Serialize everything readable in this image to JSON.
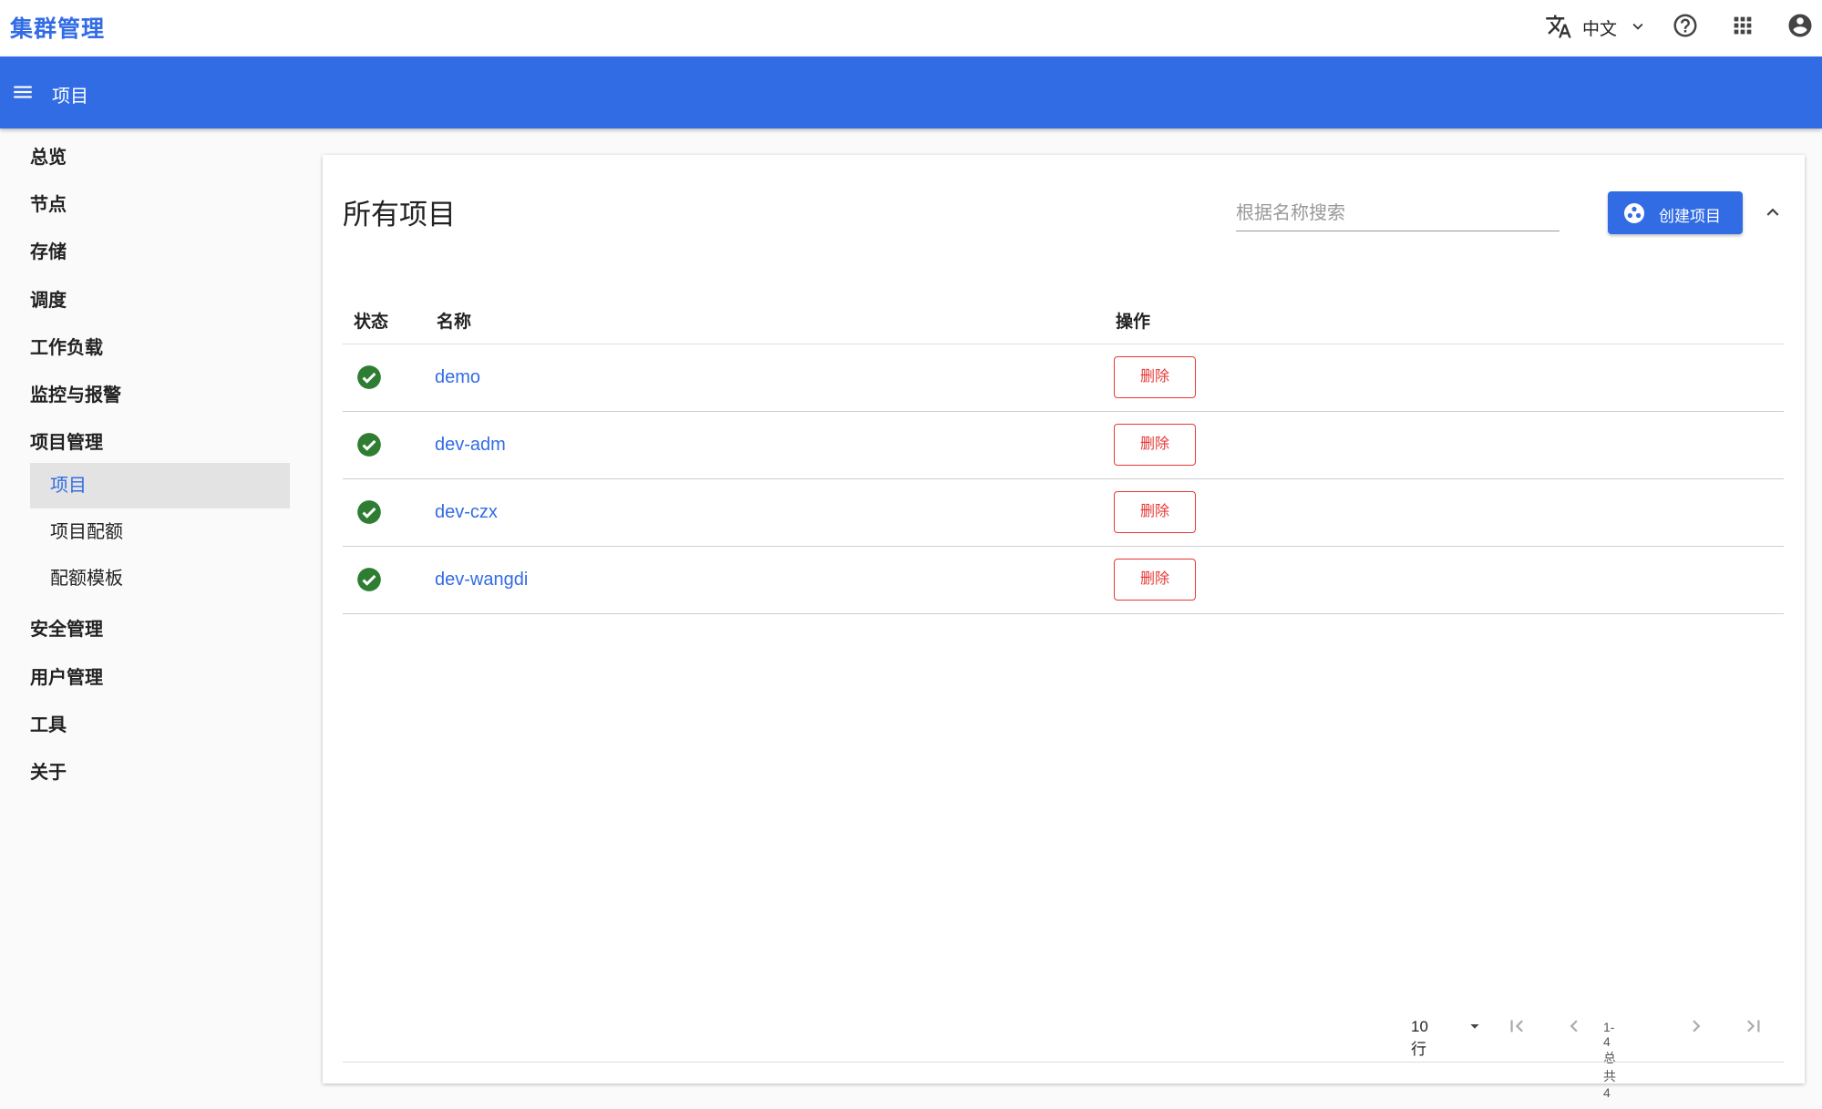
{
  "app": {
    "title": "集群管理"
  },
  "topbar": {
    "language": "中文"
  },
  "toolbar": {
    "title": "项目"
  },
  "sidebar": {
    "items": [
      {
        "label": "总览"
      },
      {
        "label": "节点"
      },
      {
        "label": "存储"
      },
      {
        "label": "调度"
      },
      {
        "label": "工作负载"
      },
      {
        "label": "监控与报警"
      },
      {
        "label": "项目管理"
      },
      {
        "label": "安全管理"
      },
      {
        "label": "用户管理"
      },
      {
        "label": "工具"
      },
      {
        "label": "关于"
      }
    ],
    "sub_items": [
      {
        "label": "项目",
        "active": true
      },
      {
        "label": "项目配额",
        "active": false
      },
      {
        "label": "配额模板",
        "active": false
      }
    ]
  },
  "card": {
    "title": "所有项目",
    "search_placeholder": "根据名称搜索",
    "create_label": "创建项目"
  },
  "table": {
    "columns": {
      "status": "状态",
      "name": "名称",
      "actions": "操作"
    },
    "rows": [
      {
        "status": "ok",
        "name": "demo",
        "action": "删除"
      },
      {
        "status": "ok",
        "name": "dev-adm",
        "action": "删除"
      },
      {
        "status": "ok",
        "name": "dev-czx",
        "action": "删除"
      },
      {
        "status": "ok",
        "name": "dev-wangdi",
        "action": "删除"
      }
    ]
  },
  "paginator": {
    "rows_per_page": "10 行",
    "range": "1-4 总共 4"
  },
  "colors": {
    "primary": "#326ce5",
    "success": "#2e7d32",
    "danger": "#e53935"
  }
}
